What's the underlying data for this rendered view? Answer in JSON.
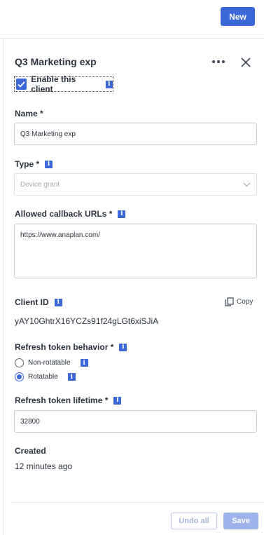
{
  "header": {
    "new_label": "New"
  },
  "panel": {
    "title": "Q3 Marketing exp",
    "enable_label": "Enable this client",
    "name": {
      "label": "Name *",
      "value": "Q3 Marketing exp"
    },
    "type": {
      "label": "Type *",
      "placeholder": "Device grant"
    },
    "callback": {
      "label": "Allowed callback URLs *",
      "value": "https://www.anaplan.com/"
    },
    "client_id": {
      "label": "Client ID",
      "copy_label": "Copy",
      "value": "yAY10GhtrX16YCZs91f24gLGt6xiSJiA"
    },
    "refresh_behavior": {
      "label": "Refresh token behavior *",
      "options": [
        {
          "label": "Non-rotatable",
          "selected": false
        },
        {
          "label": "Rotatable",
          "selected": true
        }
      ]
    },
    "lifetime": {
      "label": "Refresh token lifetime *",
      "value": "32800"
    },
    "created": {
      "label": "Created",
      "value": "12 minutes ago"
    }
  },
  "footer": {
    "undo_label": "Undo all",
    "save_label": "Save"
  },
  "colors": {
    "accent": "#3b67d8",
    "border": "#c9ced6",
    "text": "#2c3440"
  }
}
